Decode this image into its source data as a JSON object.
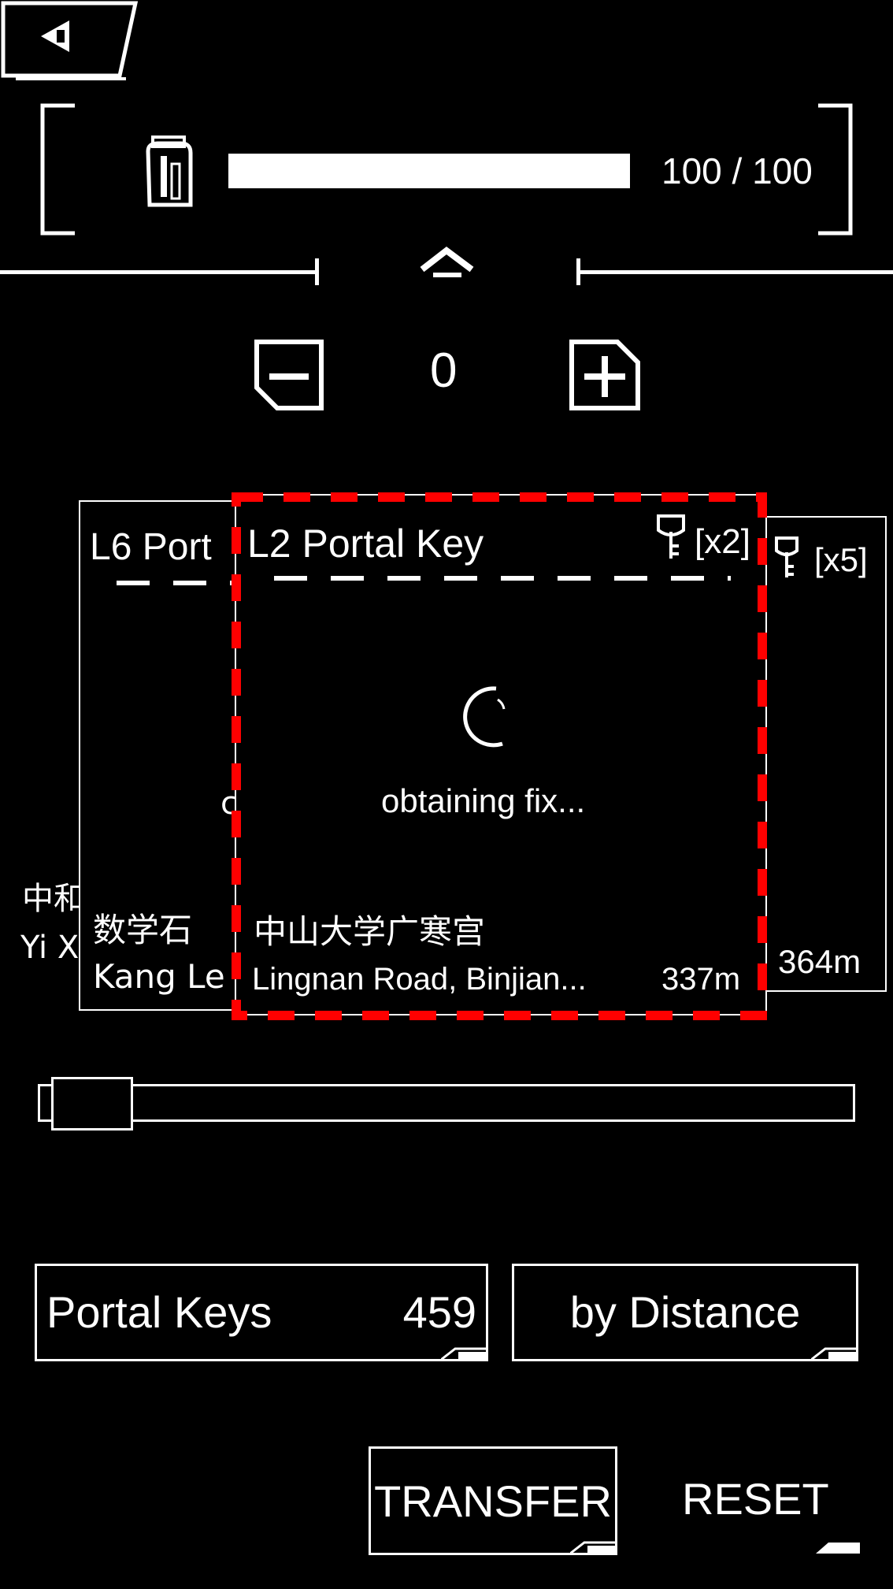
{
  "header": {
    "back_icon": "back-arrow-icon",
    "meter_icon": "xm-canister-icon",
    "meter_fill_percent": 100,
    "meter_label": "100 / 100",
    "collapse_icon": "chevron-up-icon"
  },
  "stepper": {
    "minus_icon": "minus-icon",
    "value": "0",
    "plus_icon": "plus-icon"
  },
  "carousel": {
    "left_card": {
      "title": "L6 Port",
      "name": "数学石",
      "address": "Kang Le",
      "partial_char": "c"
    },
    "center_card": {
      "title": "L2 Portal Key",
      "count": "[x2]",
      "loading_text": "obtaining fix...",
      "name": "中山大学广寒宫",
      "address": "Lingnan Road, Binjian...",
      "distance": "337m"
    },
    "right_card": {
      "count": "[x5]",
      "distance": "364m"
    },
    "far_left": {
      "name": "中和",
      "address": "Yi X"
    },
    "highlight_color": "#ff0000"
  },
  "scroller": {
    "position_fraction": 0.0
  },
  "filters": {
    "category_label": "Portal Keys",
    "category_count": "459",
    "sort_label": "by Distance"
  },
  "actions": {
    "transfer_label": "TRANSFER",
    "reset_label": "RESET"
  }
}
